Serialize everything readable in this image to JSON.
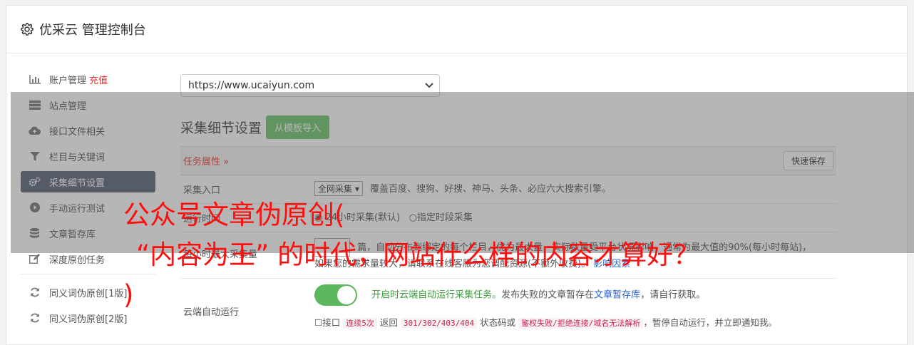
{
  "header": {
    "title": "优采云 管理控制台"
  },
  "sidebar": {
    "items": [
      {
        "label": "账户管理",
        "badge": "充值",
        "icon": "bar-chart-icon"
      },
      {
        "label": "站点管理",
        "icon": "server-icon"
      },
      {
        "label": "接口文件相关",
        "icon": "cloud-upload-icon"
      },
      {
        "label": "栏目与关键词",
        "icon": "filter-icon"
      },
      {
        "label": "采集细节设置",
        "icon": "cogs-icon"
      },
      {
        "label": "手动运行测试",
        "icon": "play-circle-icon"
      },
      {
        "label": "文章暂存库",
        "icon": "database-icon"
      },
      {
        "label": "深度原创任务",
        "icon": "edit-icon"
      },
      {
        "label": "同义词伪原创[1版]",
        "icon": "refresh-icon"
      },
      {
        "label": "同义词伪原创[2版]",
        "icon": "refresh-icon"
      }
    ]
  },
  "main": {
    "site_select": "https://www.ucaiyun.com",
    "section_title": "采集细节设置",
    "import_button": "从模板导入",
    "task_header": "任务属性 ",
    "quick_save": "快速保存",
    "rows": {
      "entry_label": "采集入口",
      "entry_select": "全网采集",
      "entry_desc": "覆盖百度、搜狗、好搜、神马、头条、必应六大搜索引擎。",
      "time_label": "运行时间",
      "time_opt1": "24小时采集(默认)",
      "time_opt2": "指定时段采集",
      "limit_label": "每小时最大采集量",
      "limit_desc1": "篇，自动分布到绑定的每个栏目，优为最大量，实际数量受平台状况影响，通常为最大值的90%(每小时每站)，",
      "limit_desc2": "如果您的需求量较大，请联系在线客服为您调配资源(不额外收费)。",
      "limit_link": "影响因素",
      "cloud_label": "云端自动运行",
      "cloud_on": "开启时云端自动运行采集任务。",
      "cloud_desc": "发布失败的文章暂存在",
      "cloud_link": "文章暂存库",
      "cloud_desc2": "，请自行获取。",
      "api_label": "接口",
      "api_code1": "连续5次",
      "api_text1": "返回",
      "api_code2": "301/302/403/404",
      "api_text2": "状态码或",
      "api_code3": "鉴权失败/拒绝连接/域名无法解析",
      "api_text3": "，暂停自动运行，并立即通知我。"
    }
  },
  "headline": {
    "line1": "公众号文章伪原创(",
    "line2": "“内容为王” 的时代，网站什么样的内容才算好？",
    "line3": ")"
  },
  "colors": {
    "accent_green": "#6bc46d",
    "active_nav": "#5a6578",
    "headline_red": "#ff0e0e"
  }
}
